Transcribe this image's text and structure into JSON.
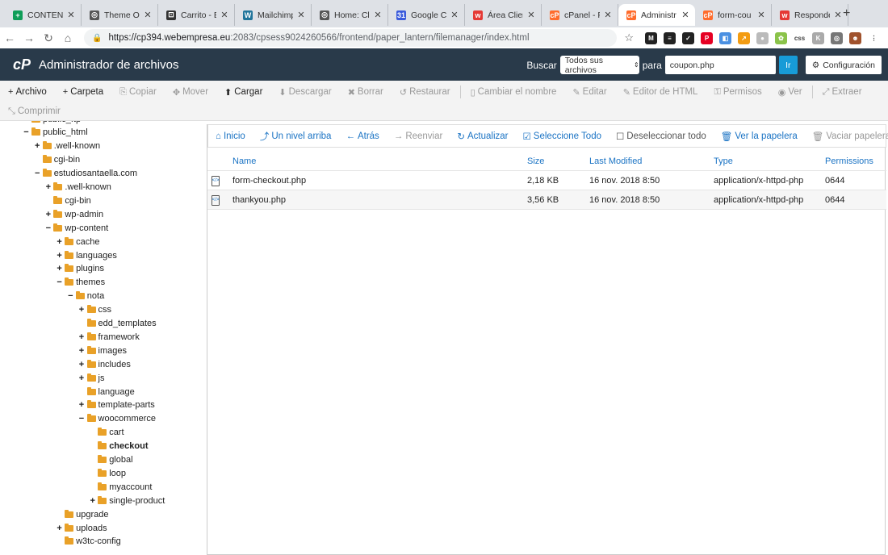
{
  "browser": {
    "tabs": [
      {
        "title": "CONTENI",
        "fav_color": "#0f9d58",
        "fav": "+"
      },
      {
        "title": "Theme Op",
        "fav_color": "#555555",
        "fav": "◎"
      },
      {
        "title": "Carrito - E",
        "fav_color": "#333333",
        "fav": "⊡"
      },
      {
        "title": "Mailchimp",
        "fav_color": "#21759b",
        "fav": "W"
      },
      {
        "title": "Home: Cl",
        "fav_color": "#555555",
        "fav": "◎"
      },
      {
        "title": "Google C",
        "fav_color": "#3b5bdb",
        "fav": "31"
      },
      {
        "title": "Área Clien",
        "fav_color": "#e53935",
        "fav": "w"
      },
      {
        "title": "cPanel - P",
        "fav_color": "#ff6c2c",
        "fav": "cP"
      },
      {
        "title": "Administr",
        "fav_color": "#ff6c2c",
        "fav": "cP"
      },
      {
        "title": "form-cou",
        "fav_color": "#ff6c2c",
        "fav": "cP"
      },
      {
        "title": "Responde",
        "fav_color": "#e53935",
        "fav": "w"
      }
    ],
    "close_glyph": "✕",
    "new_tab_glyph": "+",
    "url_host": "https://cp394.webempresa.eu",
    "url_rest": ":2083/cpsess9024260566/frontend/paper_lantern/filemanager/index.html",
    "extensions": [
      {
        "label": "M",
        "color": "#222222"
      },
      {
        "label": "≡",
        "color": "#222222"
      },
      {
        "label": "✓",
        "color": "#222222"
      },
      {
        "label": "P",
        "color": "#e60023"
      },
      {
        "label": "◧",
        "color": "#4a90e2"
      },
      {
        "label": "↗",
        "color": "#f39c12"
      },
      {
        "label": "●",
        "color": "#bbbbbb"
      },
      {
        "label": "✿",
        "color": "#8bc34a"
      },
      {
        "label": "css",
        "color": "#ffffff"
      },
      {
        "label": "K",
        "color": "#aaaaaa"
      },
      {
        "label": "◎",
        "color": "#777777"
      },
      {
        "label": "☻",
        "color": "#a0522d"
      },
      {
        "label": "⋮",
        "color": "#ffffff"
      }
    ]
  },
  "header": {
    "logo": "cP",
    "title": "Administrador de archivos",
    "search_label": "Buscar",
    "search_scope": "Todos sus archivos",
    "search_for_label": "para",
    "search_value": "coupon.php",
    "go_label": "Ir",
    "settings_label": "Configuración"
  },
  "toolbar": {
    "row1": [
      {
        "icon": "+",
        "label": "Archivo",
        "enabled": true,
        "name": "new-file-button"
      },
      {
        "icon": "+",
        "label": "Carpeta",
        "enabled": true,
        "name": "new-folder-button"
      },
      {
        "icon": "⎘",
        "label": "Copiar",
        "enabled": false,
        "name": "copy-button"
      },
      {
        "icon": "✥",
        "label": "Mover",
        "enabled": false,
        "name": "move-button"
      },
      {
        "icon": "⬆",
        "label": "Cargar",
        "enabled": true,
        "name": "upload-button"
      },
      {
        "icon": "⬇",
        "label": "Descargar",
        "enabled": false,
        "name": "download-button"
      },
      {
        "icon": "✖",
        "label": "Borrar",
        "enabled": false,
        "name": "delete-button"
      },
      {
        "icon": "↺",
        "label": "Restaurar",
        "enabled": false,
        "name": "restore-button"
      },
      {
        "sep": true
      },
      {
        "icon": "▯",
        "label": "Cambiar el nombre",
        "enabled": false,
        "name": "rename-button"
      },
      {
        "icon": "✎",
        "label": "Editar",
        "enabled": false,
        "name": "edit-button"
      },
      {
        "icon": "✎",
        "label": "Editor de HTML",
        "enabled": false,
        "name": "html-editor-button"
      },
      {
        "icon": "⚿",
        "label": "Permisos",
        "enabled": false,
        "name": "permissions-button"
      },
      {
        "icon": "◉",
        "label": "Ver",
        "enabled": false,
        "name": "view-button"
      },
      {
        "sep": true
      },
      {
        "icon": "⤢",
        "label": "Extraer",
        "enabled": false,
        "name": "extract-button"
      }
    ],
    "row2": [
      {
        "icon": "⤡",
        "label": "Comprimir",
        "enabled": false,
        "name": "compress-button"
      }
    ]
  },
  "tree": [
    {
      "label": "public_ftp",
      "depth": 1,
      "toggle": "+",
      "partial": true
    },
    {
      "label": "public_html",
      "depth": 1,
      "toggle": "−"
    },
    {
      "label": ".well-known",
      "depth": 2,
      "toggle": "+"
    },
    {
      "label": "cgi-bin",
      "depth": 2,
      "toggle": ""
    },
    {
      "label": "estudiosantaella.com",
      "depth": 2,
      "toggle": "−"
    },
    {
      "label": ".well-known",
      "depth": 3,
      "toggle": "+"
    },
    {
      "label": "cgi-bin",
      "depth": 3,
      "toggle": ""
    },
    {
      "label": "wp-admin",
      "depth": 3,
      "toggle": "+"
    },
    {
      "label": "wp-content",
      "depth": 3,
      "toggle": "−"
    },
    {
      "label": "cache",
      "depth": 4,
      "toggle": "+"
    },
    {
      "label": "languages",
      "depth": 4,
      "toggle": "+"
    },
    {
      "label": "plugins",
      "depth": 4,
      "toggle": "+"
    },
    {
      "label": "themes",
      "depth": 4,
      "toggle": "−"
    },
    {
      "label": "nota",
      "depth": 5,
      "toggle": "−"
    },
    {
      "label": "css",
      "depth": 6,
      "toggle": "+"
    },
    {
      "label": "edd_templates",
      "depth": 6,
      "toggle": ""
    },
    {
      "label": "framework",
      "depth": 6,
      "toggle": "+"
    },
    {
      "label": "images",
      "depth": 6,
      "toggle": "+"
    },
    {
      "label": "includes",
      "depth": 6,
      "toggle": "+"
    },
    {
      "label": "js",
      "depth": 6,
      "toggle": "+"
    },
    {
      "label": "language",
      "depth": 6,
      "toggle": ""
    },
    {
      "label": "template-parts",
      "depth": 6,
      "toggle": "+"
    },
    {
      "label": "woocommerce",
      "depth": 6,
      "toggle": "−"
    },
    {
      "label": "cart",
      "depth": 7,
      "toggle": ""
    },
    {
      "label": "checkout",
      "depth": 7,
      "toggle": "",
      "bold": true
    },
    {
      "label": "global",
      "depth": 7,
      "toggle": ""
    },
    {
      "label": "loop",
      "depth": 7,
      "toggle": ""
    },
    {
      "label": "myaccount",
      "depth": 7,
      "toggle": ""
    },
    {
      "label": "single-product",
      "depth": 7,
      "toggle": "+"
    },
    {
      "label": "upgrade",
      "depth": 4,
      "toggle": ""
    },
    {
      "label": "uploads",
      "depth": 4,
      "toggle": "+"
    },
    {
      "label": "w3tc-config",
      "depth": 4,
      "toggle": ""
    }
  ],
  "nav": [
    {
      "icon": "⌂",
      "label": "Inicio",
      "enabled": true,
      "name": "home-button"
    },
    {
      "icon": "⤴",
      "label": "Un nivel arriba",
      "enabled": true,
      "name": "up-one-level-button"
    },
    {
      "icon": "←",
      "label": "Atrás",
      "enabled": true,
      "name": "back-button"
    },
    {
      "icon": "→",
      "label": "Reenviar",
      "enabled": false,
      "name": "forward-button"
    },
    {
      "icon": "↻",
      "label": "Actualizar",
      "enabled": true,
      "name": "reload-button"
    },
    {
      "icon": "☑",
      "label": "Seleccione Todo",
      "enabled": true,
      "name": "select-all-button"
    },
    {
      "icon": "☐",
      "label": "Deseleccionar todo",
      "enabled": true,
      "dark": true,
      "name": "deselect-all-button"
    },
    {
      "sep": true
    },
    {
      "icon": "🗑",
      "label": "Ver la papelera",
      "enabled": true,
      "name": "view-trash-button"
    },
    {
      "sep": true
    },
    {
      "icon": "🗑",
      "label": "Vaciar papelera",
      "enabled": false,
      "name": "empty-trash-button"
    }
  ],
  "files": {
    "columns": {
      "name": "Name",
      "size": "Size",
      "modified": "Last Modified",
      "type": "Type",
      "perms": "Permissions"
    },
    "rows": [
      {
        "name": "form-checkout.php",
        "size": "2,18 KB",
        "modified": "16 nov. 2018 8:50",
        "type": "application/x-httpd-php",
        "perms": "0644"
      },
      {
        "name": "thankyou.php",
        "size": "3,56 KB",
        "modified": "16 nov. 2018 8:50",
        "type": "application/x-httpd-php",
        "perms": "0644"
      }
    ]
  }
}
